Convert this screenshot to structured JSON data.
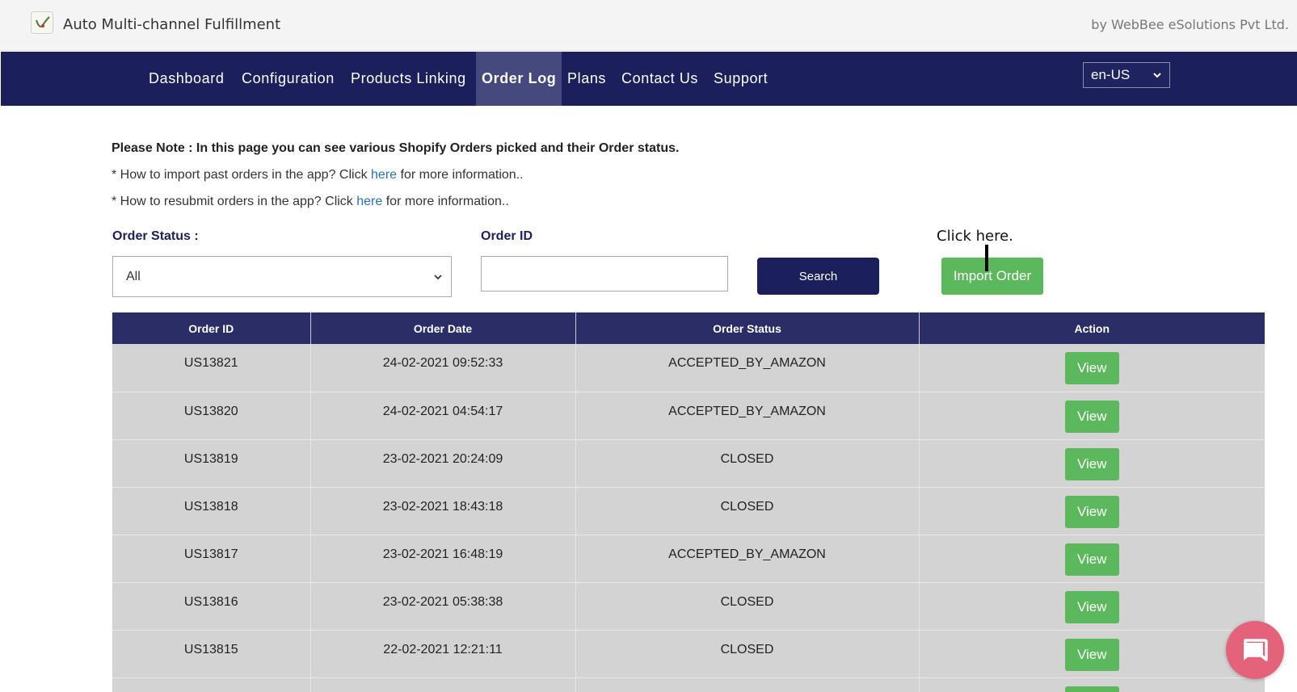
{
  "app": {
    "title": "Auto Multi-channel Fulfillment",
    "vendor": "by WebBee eSolutions Pvt Ltd."
  },
  "nav": {
    "items": [
      {
        "label": "Dashboard",
        "active": false
      },
      {
        "label": "Configuration",
        "active": false
      },
      {
        "label": "Products Linking",
        "active": false
      },
      {
        "label": "Order Log",
        "active": true
      },
      {
        "label": "Plans",
        "active": false
      },
      {
        "label": "Contact Us",
        "active": false
      },
      {
        "label": "Support",
        "active": false
      }
    ],
    "language": "en-US"
  },
  "notes": {
    "main": "Please Note : In this page you can see various Shopify Orders picked and their Order status.",
    "import_prefix": "* How to import past orders in the app? Click ",
    "import_link": "here",
    "import_suffix": " for more information..",
    "resubmit_prefix": "* How to resubmit orders in the app? Click ",
    "resubmit_link": "here",
    "resubmit_suffix": " for more information.."
  },
  "filters": {
    "status_label": "Order Status :",
    "status_value": "All",
    "orderid_label": "Order ID",
    "orderid_value": "",
    "search_label": "Search",
    "import_label": "Import Order"
  },
  "annotation": "Click here.",
  "table": {
    "headers": [
      "Order ID",
      "Order Date",
      "Order Status",
      "Action"
    ],
    "action_label": "View",
    "rows": [
      {
        "id": "US13821",
        "date": "24-02-2021 09:52:33",
        "status": "ACCEPTED_BY_AMAZON"
      },
      {
        "id": "US13820",
        "date": "24-02-2021 04:54:17",
        "status": "ACCEPTED_BY_AMAZON"
      },
      {
        "id": "US13819",
        "date": "23-02-2021 20:24:09",
        "status": "CLOSED"
      },
      {
        "id": "US13818",
        "date": "23-02-2021 18:43:18",
        "status": "CLOSED"
      },
      {
        "id": "US13817",
        "date": "23-02-2021 16:48:19",
        "status": "ACCEPTED_BY_AMAZON"
      },
      {
        "id": "US13816",
        "date": "23-02-2021 05:38:38",
        "status": "CLOSED"
      },
      {
        "id": "US13815",
        "date": "22-02-2021 12:21:11",
        "status": "CLOSED"
      }
    ]
  },
  "colors": {
    "nav_bg": "#1b1f5c",
    "nav_active_bg": "#46497d",
    "table_header_bg": "#2b2e66",
    "row_bg": "#d3d3d3",
    "action_green": "#5cb85c",
    "link_blue": "#2c6fb7",
    "chat_pink": "#e4637a"
  }
}
